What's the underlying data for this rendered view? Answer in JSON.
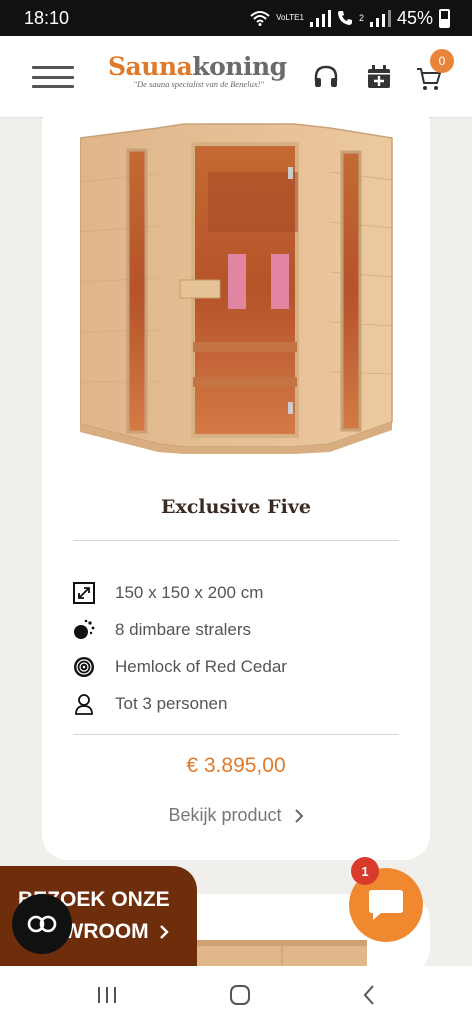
{
  "status": {
    "time": "18:10",
    "network": "VoLTE1",
    "sim2": "2",
    "battery": "45%"
  },
  "header": {
    "logo_part1": "Sauna",
    "logo_part2": "koning",
    "tagline": "\"De sauna specialist van de Benelux!\"",
    "cart_count": "0",
    "icons": [
      "hamburger-menu-icon",
      "headset-icon",
      "calendar-add-icon",
      "cart-icon"
    ]
  },
  "product": {
    "name": "Exclusive Five",
    "specs": [
      {
        "icon": "dimensions-icon",
        "text": "150 x 150 x 200 cm"
      },
      {
        "icon": "radiator-icon",
        "text": "8 dimbare stralers"
      },
      {
        "icon": "wood-icon",
        "text": "Hemlock of Red Cedar"
      },
      {
        "icon": "person-icon",
        "text": "Tot 3 personen"
      }
    ],
    "price": "€ 3.895,00",
    "view_label": "Bekijk product"
  },
  "showroom": {
    "line1": "BEZOEK ONZE",
    "line2": "SHOWROOM"
  },
  "chat": {
    "badge": "1"
  },
  "colors": {
    "accent": "#e07a2b",
    "showroom": "#6e2e0c",
    "chat": "#f0882f",
    "badge": "#d83a2c"
  }
}
